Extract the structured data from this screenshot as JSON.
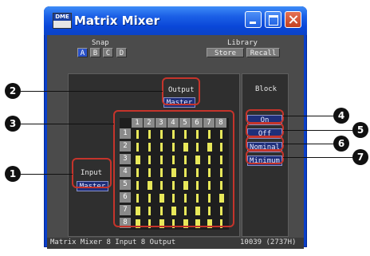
{
  "window": {
    "title": "Matrix Mixer",
    "icon_text_top": "DME",
    "icon_text_bottom": ""
  },
  "snap": {
    "label": "Snap",
    "buttons": [
      "A",
      "B",
      "C",
      "D"
    ],
    "active": "A"
  },
  "library": {
    "label": "Library",
    "store": "Store",
    "recall": "Recall"
  },
  "output": {
    "label": "Output",
    "master": "Master"
  },
  "input": {
    "label": "Input",
    "master": "Master"
  },
  "block": {
    "label": "Block",
    "buttons": [
      "On",
      "Off",
      "Nominal",
      "Minimum"
    ]
  },
  "matrix": {
    "columns": [
      "1",
      "2",
      "3",
      "4",
      "5",
      "6",
      "7",
      "8"
    ],
    "rows": [
      "1",
      "2",
      "3",
      "4",
      "5",
      "6",
      "7",
      "8"
    ],
    "levels": [
      [
        0.3,
        0.3,
        0.3,
        0.3,
        0.3,
        0.3,
        0.3,
        0.3
      ],
      [
        0.3,
        0.3,
        0.3,
        0.3,
        0.6,
        0.3,
        0.6,
        0.3
      ],
      [
        0.6,
        0.3,
        0.3,
        0.3,
        0.3,
        0.6,
        0.3,
        0.3
      ],
      [
        0.3,
        0.3,
        0.3,
        0.6,
        0.3,
        0.3,
        0.3,
        0.3
      ],
      [
        0.3,
        0.6,
        0.3,
        0.3,
        0.6,
        0.3,
        0.3,
        0.3
      ],
      [
        0.3,
        0.3,
        0.6,
        0.3,
        0.3,
        0.3,
        0.3,
        0.6
      ],
      [
        0.6,
        0.3,
        0.3,
        0.6,
        0.3,
        0.6,
        0.3,
        0.3
      ],
      [
        0.6,
        0.3,
        0.6,
        0.3,
        0.6,
        0.6,
        0.6,
        0.3
      ]
    ]
  },
  "status": {
    "left": "Matrix Mixer   8 Input 8 Output",
    "right": "10039 (2737H)"
  },
  "callouts": [
    "1",
    "2",
    "3",
    "4",
    "5",
    "6",
    "7"
  ],
  "colors": {
    "titlebar": "#1b5fe6",
    "client": "#4b4b4b",
    "highlight": "#c5342b",
    "level": "#e8e85a",
    "button_active": "#2b52c9"
  }
}
